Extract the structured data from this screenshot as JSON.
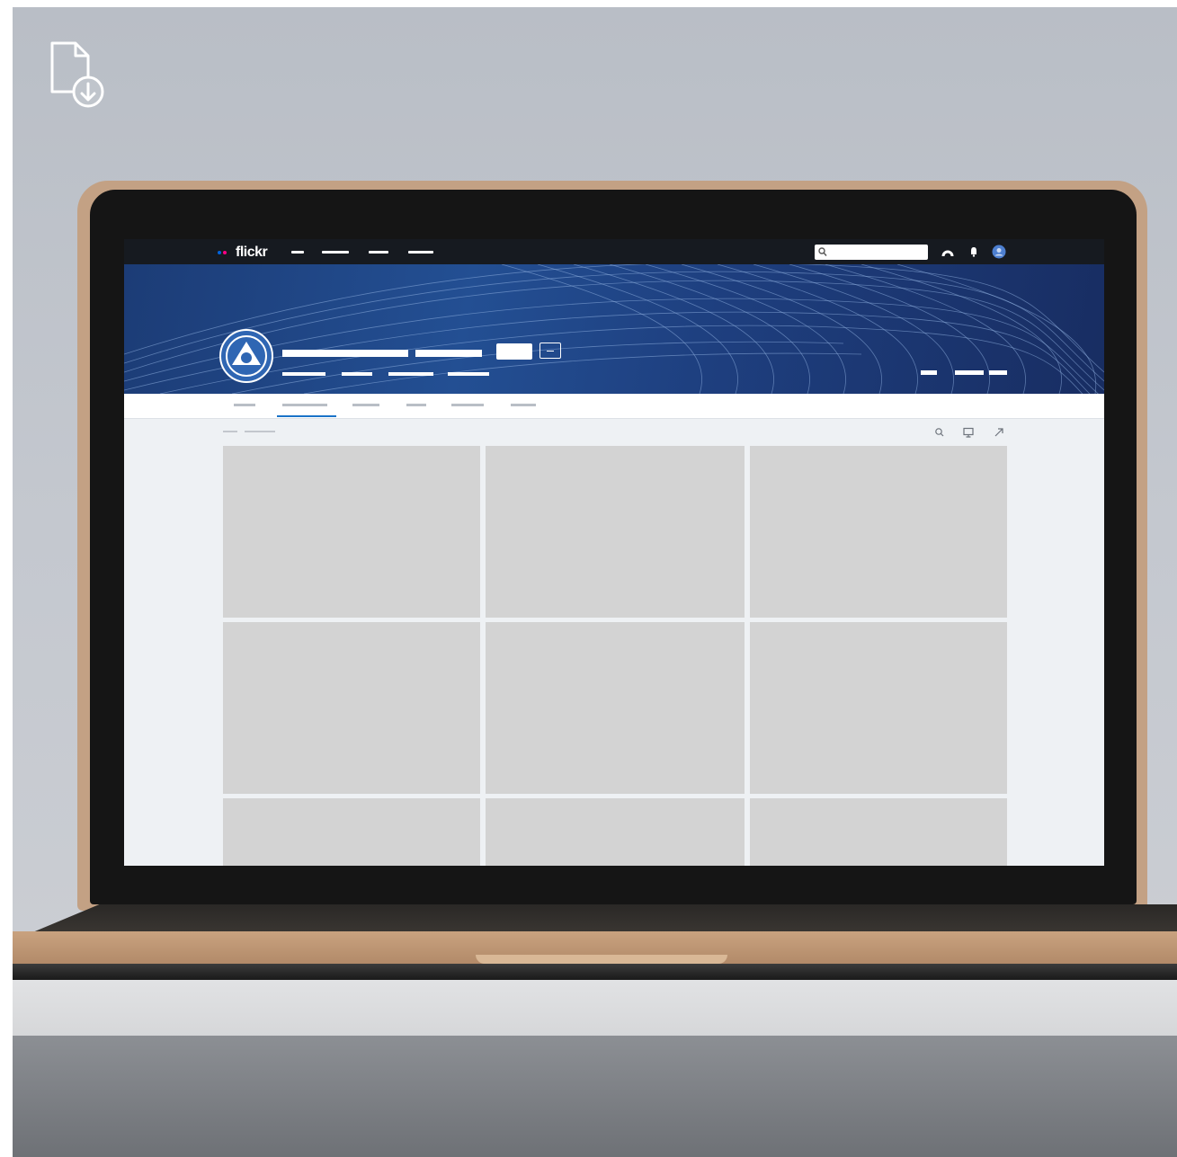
{
  "browser": {
    "logo_text": "flickr",
    "search": {
      "placeholder": ""
    }
  },
  "icons": {
    "download_file": "file-download-icon",
    "search": "search-icon",
    "upload": "upload-cloud-icon",
    "notifications": "bell-icon",
    "account": "avatar",
    "toolbar": [
      "magnifier-icon",
      "slideshow-icon",
      "share-icon"
    ]
  },
  "colors": {
    "nav_background": "#161a20",
    "banner": "#234f93",
    "tab_active_underline": "#1a73c8",
    "photo_placeholder": "#d3d3d3",
    "laptop_shell": "#c3a184",
    "logo_dot_blue": "#0063dc",
    "logo_dot_pink": "#ff0084"
  },
  "photo_grid": {
    "rows": 3,
    "columns": 3
  }
}
